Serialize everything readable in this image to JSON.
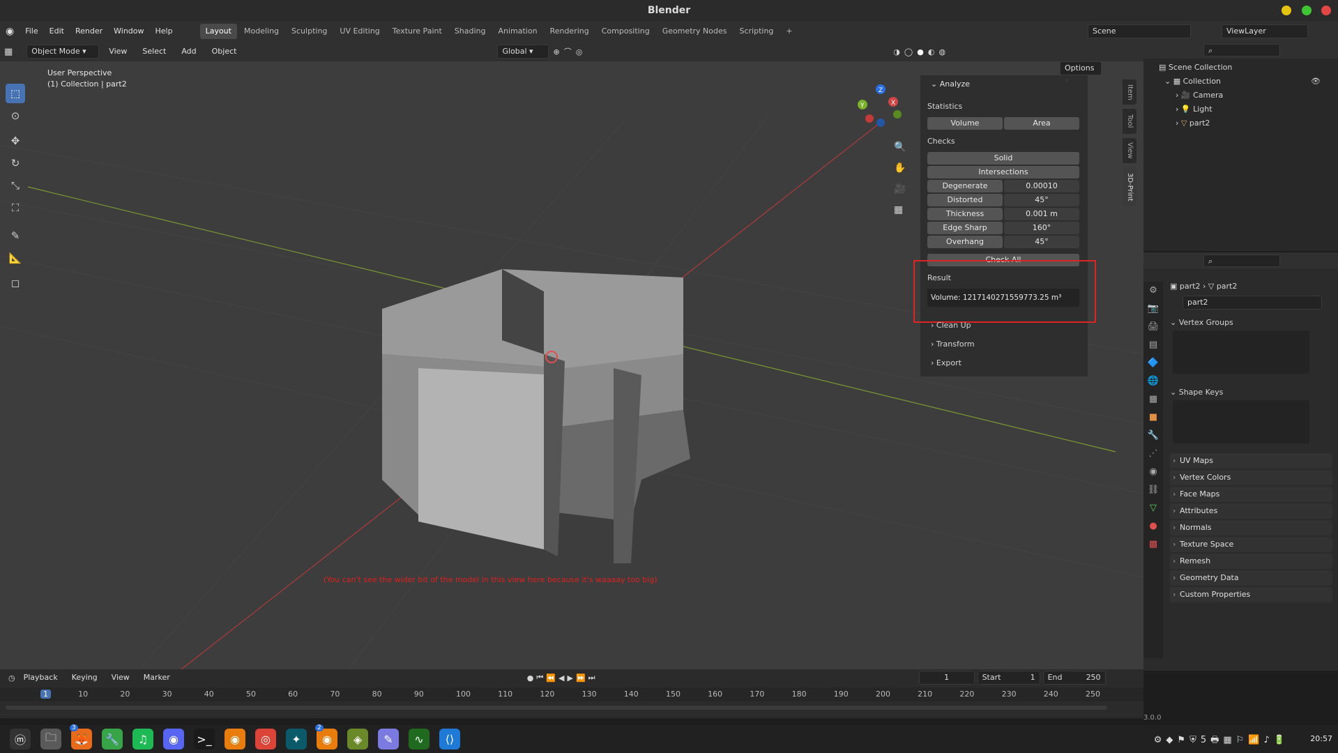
{
  "window": {
    "title": "Blender"
  },
  "menu": {
    "items": [
      "File",
      "Edit",
      "Render",
      "Window",
      "Help"
    ],
    "workspaces": [
      "Layout",
      "Modeling",
      "Sculpting",
      "UV Editing",
      "Texture Paint",
      "Shading",
      "Animation",
      "Rendering",
      "Compositing",
      "Geometry Nodes",
      "Scripting"
    ],
    "add_tab": "+",
    "scene": "Scene",
    "viewlayer": "ViewLayer"
  },
  "viewport_header": {
    "mode": "Object Mode",
    "menus": [
      "View",
      "Select",
      "Add",
      "Object"
    ],
    "orientation": "Global",
    "options": "Options"
  },
  "viewport": {
    "perspective": "User Perspective",
    "collection": "(1) Collection | part2",
    "annotation": "(You can't see the wider bit of the model in this view here because it's waaaay too big)",
    "axis_x": "X",
    "axis_y": "Y",
    "axis_z": "Z"
  },
  "npanel": {
    "section": "Analyze",
    "statistics": "Statistics",
    "volume_btn": "Volume",
    "area_btn": "Area",
    "checks": "Checks",
    "solid": "Solid",
    "intersections": "Intersections",
    "checks_rows": [
      {
        "label": "Degenerate",
        "value": "0.00010"
      },
      {
        "label": "Distorted",
        "value": "45°"
      },
      {
        "label": "Thickness",
        "value": "0.001 m"
      },
      {
        "label": "Edge Sharp",
        "value": "160°"
      },
      {
        "label": "Overhang",
        "value": "45°"
      }
    ],
    "check_all": "Check All",
    "result": "Result",
    "result_value": "Volume: 1217140271559773.25 m³",
    "collapsed": [
      "Clean Up",
      "Transform",
      "Export"
    ],
    "tabs": [
      "Item",
      "Tool",
      "View",
      "3D-Print"
    ]
  },
  "outliner": {
    "root": "Scene Collection",
    "collection": "Collection",
    "items": [
      "Camera",
      "Light",
      "part2"
    ]
  },
  "properties": {
    "breadcrumb_obj": "part2",
    "breadcrumb_data": "part2",
    "mesh_name": "part2",
    "vertex_groups": "Vertex Groups",
    "shape_keys": "Shape Keys",
    "sections": [
      "UV Maps",
      "Vertex Colors",
      "Face Maps",
      "Attributes",
      "Normals",
      "Texture Space",
      "Remesh",
      "Geometry Data",
      "Custom Properties"
    ]
  },
  "timeline": {
    "menus": [
      "Playback",
      "Keying",
      "View",
      "Marker"
    ],
    "current_frame": "1",
    "start_label": "Start",
    "start": "1",
    "end_label": "End",
    "end": "250",
    "ticks": [
      "1",
      "10",
      "20",
      "30",
      "40",
      "50",
      "60",
      "70",
      "80",
      "90",
      "100",
      "110",
      "120",
      "130",
      "140",
      "150",
      "160",
      "170",
      "180",
      "190",
      "200",
      "210",
      "220",
      "230",
      "240",
      "250"
    ]
  },
  "status": {
    "version": "3.0.0"
  },
  "taskbar": {
    "clock": "20:57",
    "badge1": "3",
    "badge2": "2",
    "tray_num": "5"
  }
}
